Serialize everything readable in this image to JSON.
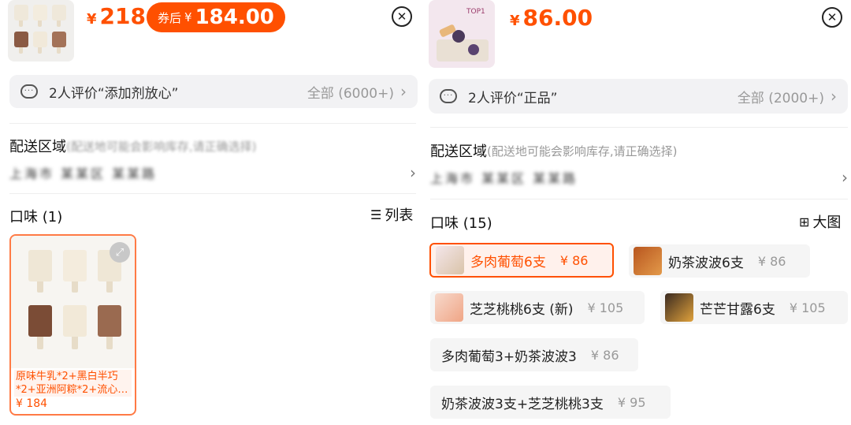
{
  "left": {
    "price": {
      "currency": "¥",
      "amount": "218"
    },
    "coupon": {
      "prefix": "券后",
      "currency": "¥",
      "amount": "184.00"
    },
    "review": {
      "text": "2人评价“添加剂放心”",
      "all": "全部 (6000+)"
    },
    "delivery": {
      "title": "配送区域",
      "note": "(配送地可能会影响库存,请正确选择)",
      "address": "上海市 某某区 某某路"
    },
    "flavor": {
      "title": "口味 (1)",
      "toggle": "列表"
    },
    "option_card": {
      "text": "原味牛乳*2+黑白半巧*2+亚洲阿粽*2+流心…",
      "price": "¥ 184"
    }
  },
  "right": {
    "price": {
      "currency": "¥",
      "amount": "86.00"
    },
    "thumb_caption": "TOP1",
    "review": {
      "text": "2人评价“正品”",
      "all": "全部 (2000+)"
    },
    "delivery": {
      "title": "配送区域",
      "note": "(配送地可能会影响库存,请正确选择)",
      "address": "上海市 某某区 某某路"
    },
    "flavor": {
      "title": "口味 (15)",
      "toggle": "大图"
    },
    "options": [
      {
        "label": "多肉葡萄6支",
        "price": "¥ 86",
        "selected": true
      },
      {
        "label": "奶茶波波6支",
        "price": "¥ 86"
      },
      {
        "label": "芝芝桃桃6支 (新)",
        "price": "¥ 105"
      },
      {
        "label": "芒芒甘露6支",
        "price": "¥ 105"
      },
      {
        "label": "多肉葡萄3+奶茶波波3",
        "price": "¥ 86"
      },
      {
        "label": "奶茶波波3支+芝芝桃桃3支",
        "price": "¥ 95"
      }
    ]
  },
  "colors": {
    "accent": "#ff5000",
    "chip_bg": "#f5f5f5",
    "selected_bg": "#fff1ec"
  },
  "icons": [
    "close-icon",
    "chat-bubble-icon",
    "chevron-right-icon",
    "grid-icon",
    "list-icon",
    "expand-icon"
  ]
}
